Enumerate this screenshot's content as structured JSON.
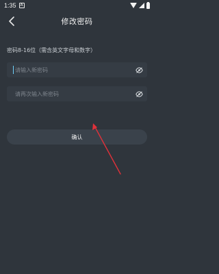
{
  "status_bar": {
    "time": "1:35",
    "notification_glyph": "A",
    "icons": [
      "wifi-icon",
      "signal-icon",
      "battery-icon"
    ]
  },
  "header": {
    "title": "修改密码",
    "back_icon": "chevron-left-icon"
  },
  "form": {
    "hint": "密码8-16位（需含英文字母和数字）",
    "new_password": {
      "placeholder": "请输入新密码",
      "value": ""
    },
    "confirm_password": {
      "placeholder": "请再次输入新密码",
      "value": ""
    },
    "visibility_icon": "eye-off-icon",
    "confirm_label": "确认"
  },
  "colors": {
    "background": "#2f353c",
    "field": "#353c44",
    "button": "#3a424b",
    "annotation": "#e0313a",
    "caret": "#6fd3ff"
  }
}
